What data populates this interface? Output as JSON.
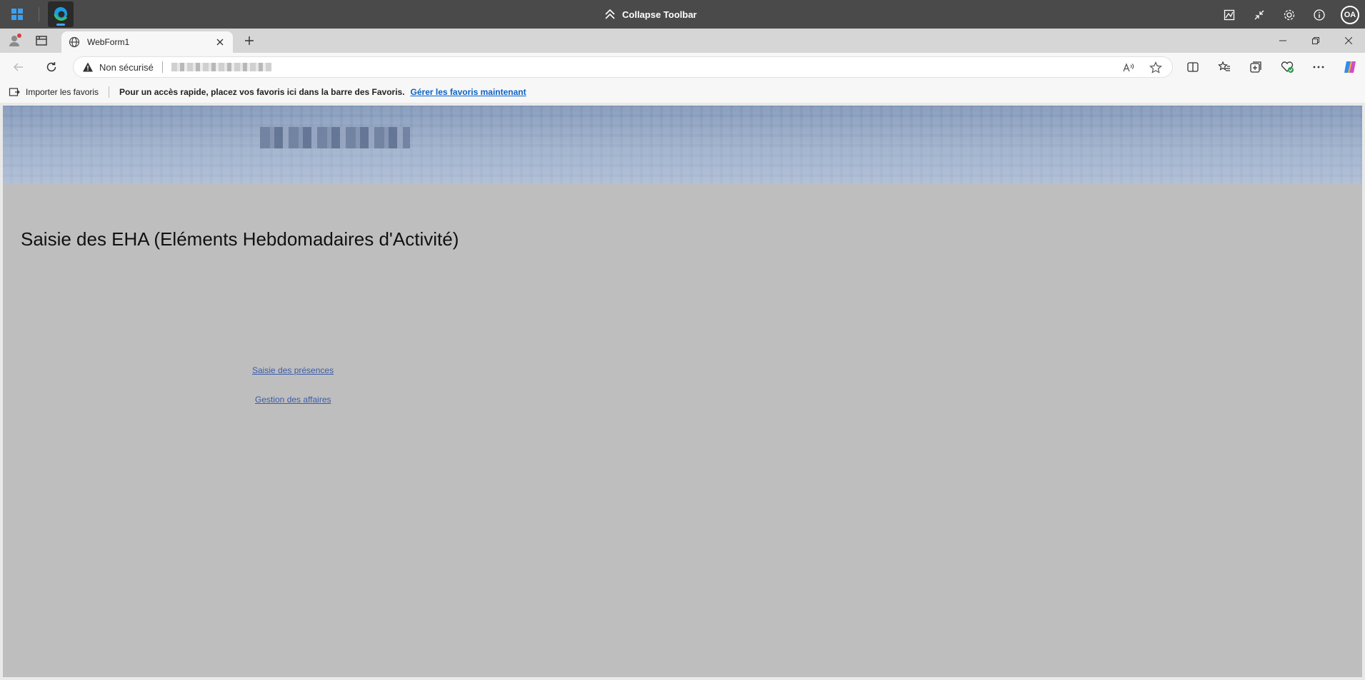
{
  "remote_toolbar": {
    "center_label": "Collapse Toolbar",
    "avatar_initials": "OA",
    "icons": [
      "windows-icon",
      "edge-icon",
      "chevrons-up-icon",
      "image-icon",
      "minimize-arrows-icon",
      "gear-icon",
      "info-icon"
    ]
  },
  "tabbar": {
    "tab_title": "WebForm1"
  },
  "addressbar": {
    "security_label": "Non sécurisé"
  },
  "favorites_bar": {
    "import_label": "Importer les favoris",
    "message": "Pour un accès rapide, placez vos favoris ici dans la barre des Favoris.",
    "manage_link": "Gérer les favoris maintenant"
  },
  "page": {
    "title": "Saisie des EHA (Eléments Hebdomadaires d'Activité)",
    "links": [
      "Saisie des présences",
      "Gestion des affaires"
    ]
  },
  "colors": {
    "page_bg": "#bebebe",
    "banner_top": "#7d93b5",
    "banner_bottom": "#aab9d1",
    "link": "#3b5ca8",
    "fav_link": "#0b63c5"
  }
}
